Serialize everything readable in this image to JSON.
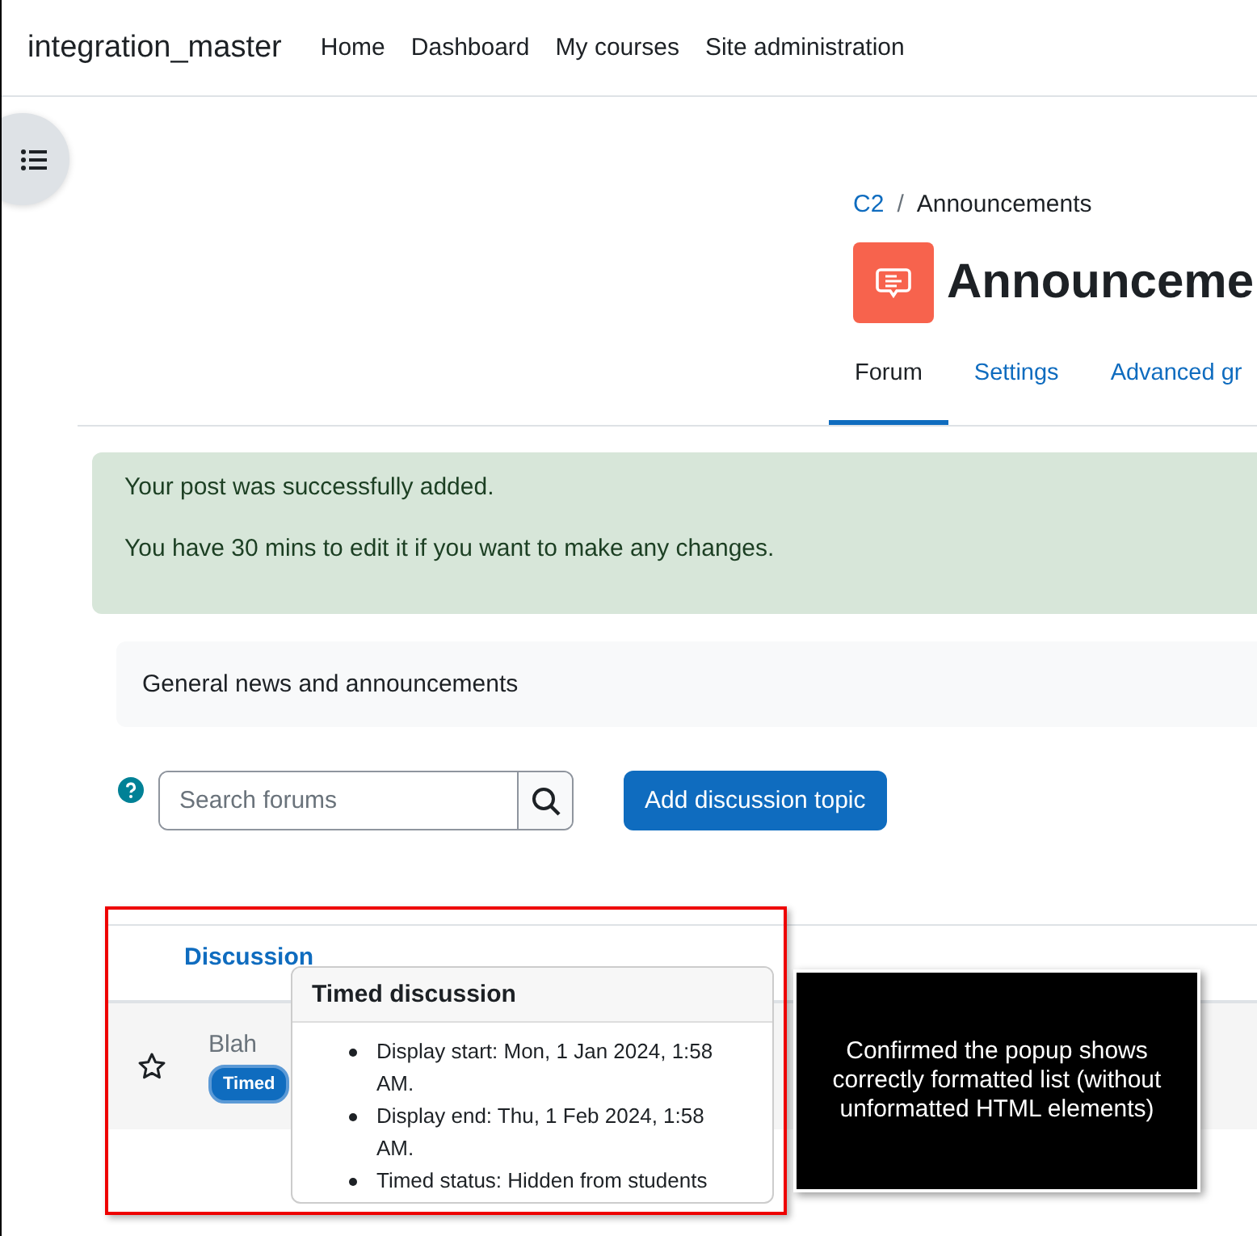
{
  "navbar": {
    "brand": "integration_master",
    "links": [
      {
        "label": "Home"
      },
      {
        "label": "Dashboard"
      },
      {
        "label": "My courses"
      },
      {
        "label": "Site administration"
      }
    ]
  },
  "breadcrumb": {
    "separator": "/",
    "items": [
      {
        "label": "C2",
        "link": true
      },
      {
        "label": "Announcements",
        "link": false
      }
    ]
  },
  "page_title": "Announceme",
  "tabs": [
    {
      "label": "Forum",
      "selected": true
    },
    {
      "label": "Settings",
      "selected": false
    },
    {
      "label": "Advanced gr",
      "selected": false
    }
  ],
  "alert": {
    "lines": [
      "Your post was successfully added.",
      "You have 30 mins to edit it if you want to make any changes."
    ]
  },
  "forum_intro": "General news and announcements",
  "search": {
    "placeholder": "Search forums"
  },
  "add_button": "Add discussion topic",
  "table": {
    "columns": [
      "Discussion"
    ],
    "rows": [
      {
        "starred": false,
        "title": "Blah",
        "badge": "Timed"
      }
    ]
  },
  "popover": {
    "title": "Timed discussion",
    "items": [
      "Display start: Mon, 1 Jan 2024, 1:58 AM.",
      "Display end: Thu, 1 Feb 2024, 1:58 AM.",
      "Timed status: Hidden from students"
    ]
  },
  "annotation": {
    "text": "Confirmed the popup shows correctly formatted list (without unformatted HTML elements)"
  }
}
